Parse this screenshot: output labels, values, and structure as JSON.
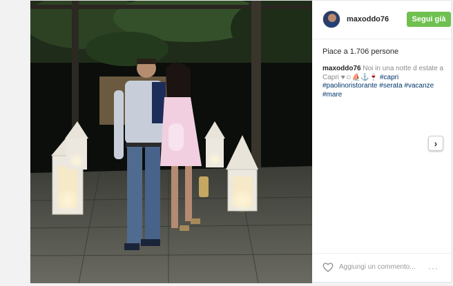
{
  "post": {
    "username": "maxoddo76",
    "follow_label": "Segui già",
    "likes_text": "Piace a 1.706 persone",
    "caption": {
      "author": "maxoddo76",
      "text_before": " Noi in una notte d estate a Capri ",
      "emoji": "♥☺⛵⚓🍷 ",
      "tags": [
        "#capri",
        "#paolinoristorante",
        "#serata",
        "#vacanze",
        "#mare"
      ]
    },
    "comment_placeholder": "Aggiungi un commento...",
    "more_label": "···"
  },
  "nav": {
    "next_label": "›"
  },
  "colors": {
    "follow_button": "#70c050",
    "hashtag": "#003569"
  },
  "icons": {
    "like": "heart-outline-icon",
    "next": "chevron-right-icon"
  }
}
